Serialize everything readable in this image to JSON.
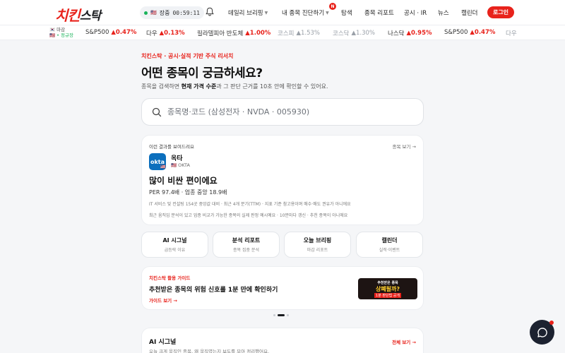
{
  "header": {
    "logo_part1": "치킨",
    "logo_part2": "스탁",
    "market_status": "장중",
    "market_flag": "🇺🇸",
    "timer": "00:59:11",
    "nav": [
      {
        "label": "데일리 브리핑",
        "has_chevron": true
      },
      {
        "label": "내 종목 진단하기",
        "has_chevron": true
      },
      {
        "label": "탐색",
        "has_chevron": false
      },
      {
        "label": "종목 리포트",
        "has_chevron": false
      },
      {
        "label": "공시 · IR",
        "has_chevron": false
      },
      {
        "label": "뉴스",
        "has_chevron": false
      },
      {
        "label": "캘린더",
        "has_chevron": false
      }
    ],
    "new_badge": "N",
    "login_label": "로그인"
  },
  "ticker": {
    "status_kr": "🇰🇷 마감",
    "status_us": "🇺🇸 • 정규장",
    "items": [
      {
        "name": "S&P500",
        "value": "▲0.47%",
        "faded": false
      },
      {
        "name": "다우",
        "value": "▲0.13%",
        "faded": false
      },
      {
        "name": "필라델피아 반도체",
        "value": "▲1.00%",
        "faded": false
      },
      {
        "name": "코스피",
        "value": "▲1.53%",
        "faded": true
      },
      {
        "name": "코스닥",
        "value": "▲1.30%",
        "faded": true
      },
      {
        "name": "나스닥",
        "value": "▲0.95%",
        "faded": false
      },
      {
        "name": "S&P500",
        "value": "▲0.47%",
        "faded": false
      },
      {
        "name": "다우",
        "value": "",
        "faded": true
      }
    ]
  },
  "hero": {
    "eyebrow": "치킨스탁 · 공시·실적 기반 주식 리서치",
    "title": "어떤 종목이 궁금하세요?",
    "subtitle_pre": "종목을 검색하면 ",
    "subtitle_bold": "현재 가격 수준",
    "subtitle_post": "과 그 판단 근거를 10초 안에 확인할 수 있어요."
  },
  "search": {
    "placeholder": "종목명·코드 (삼성전자 · NVDA · 005930)"
  },
  "example_card": {
    "header": "이런 결과를 보여드려요",
    "link": "종목 보기 →",
    "logo_text": "okta",
    "flag": "🇺🇸",
    "name": "옥타",
    "code": "🇺🇸 OKTA",
    "verdict": "많이 비싼 편이에요",
    "per": "PER 97.4배 · 업종 중앙 18.9배",
    "note1": "IT 서비스 및 컨설팅 154곳 중앙값 대비 · 최근 4개 분기(TTM) · 지표 기준 참고용이며 매수·매도 권유가 아니에요",
    "note2": "최근 움직임 분석이 있고 업종 비교가 가능한 종목의 실제 판정 예시예요 · 10분마다 갱신 · 추천 종목이 아니에요"
  },
  "quick_links": [
    {
      "title": "AI 시그널",
      "sub": "급등락 이유"
    },
    {
      "title": "분석 리포트",
      "sub": "종목 집중 분석"
    },
    {
      "title": "오늘 브리핑",
      "sub": "마감 리포트"
    },
    {
      "title": "캘린더",
      "sub": "실적·이벤트"
    }
  ],
  "guide_banner": {
    "eyebrow": "치킨스탁 활용 가이드",
    "title": "추천받은 종목의 위험 신호를 1분 만에 확인하기",
    "link": "가이드 보기 →",
    "thumb_line1": "추천받은 종목",
    "thumb_line2": "상폐될까?",
    "thumb_line3": "1분 판단법 공개"
  },
  "carousel": {
    "active_index": 1,
    "count": 3
  },
  "signal_section": {
    "title": "AI 시그널",
    "subtitle": "오늘 크게 움직인 종목, 왜 움직였는지 보도를 모아 정리했어요.",
    "link": "전체 보기 →"
  }
}
